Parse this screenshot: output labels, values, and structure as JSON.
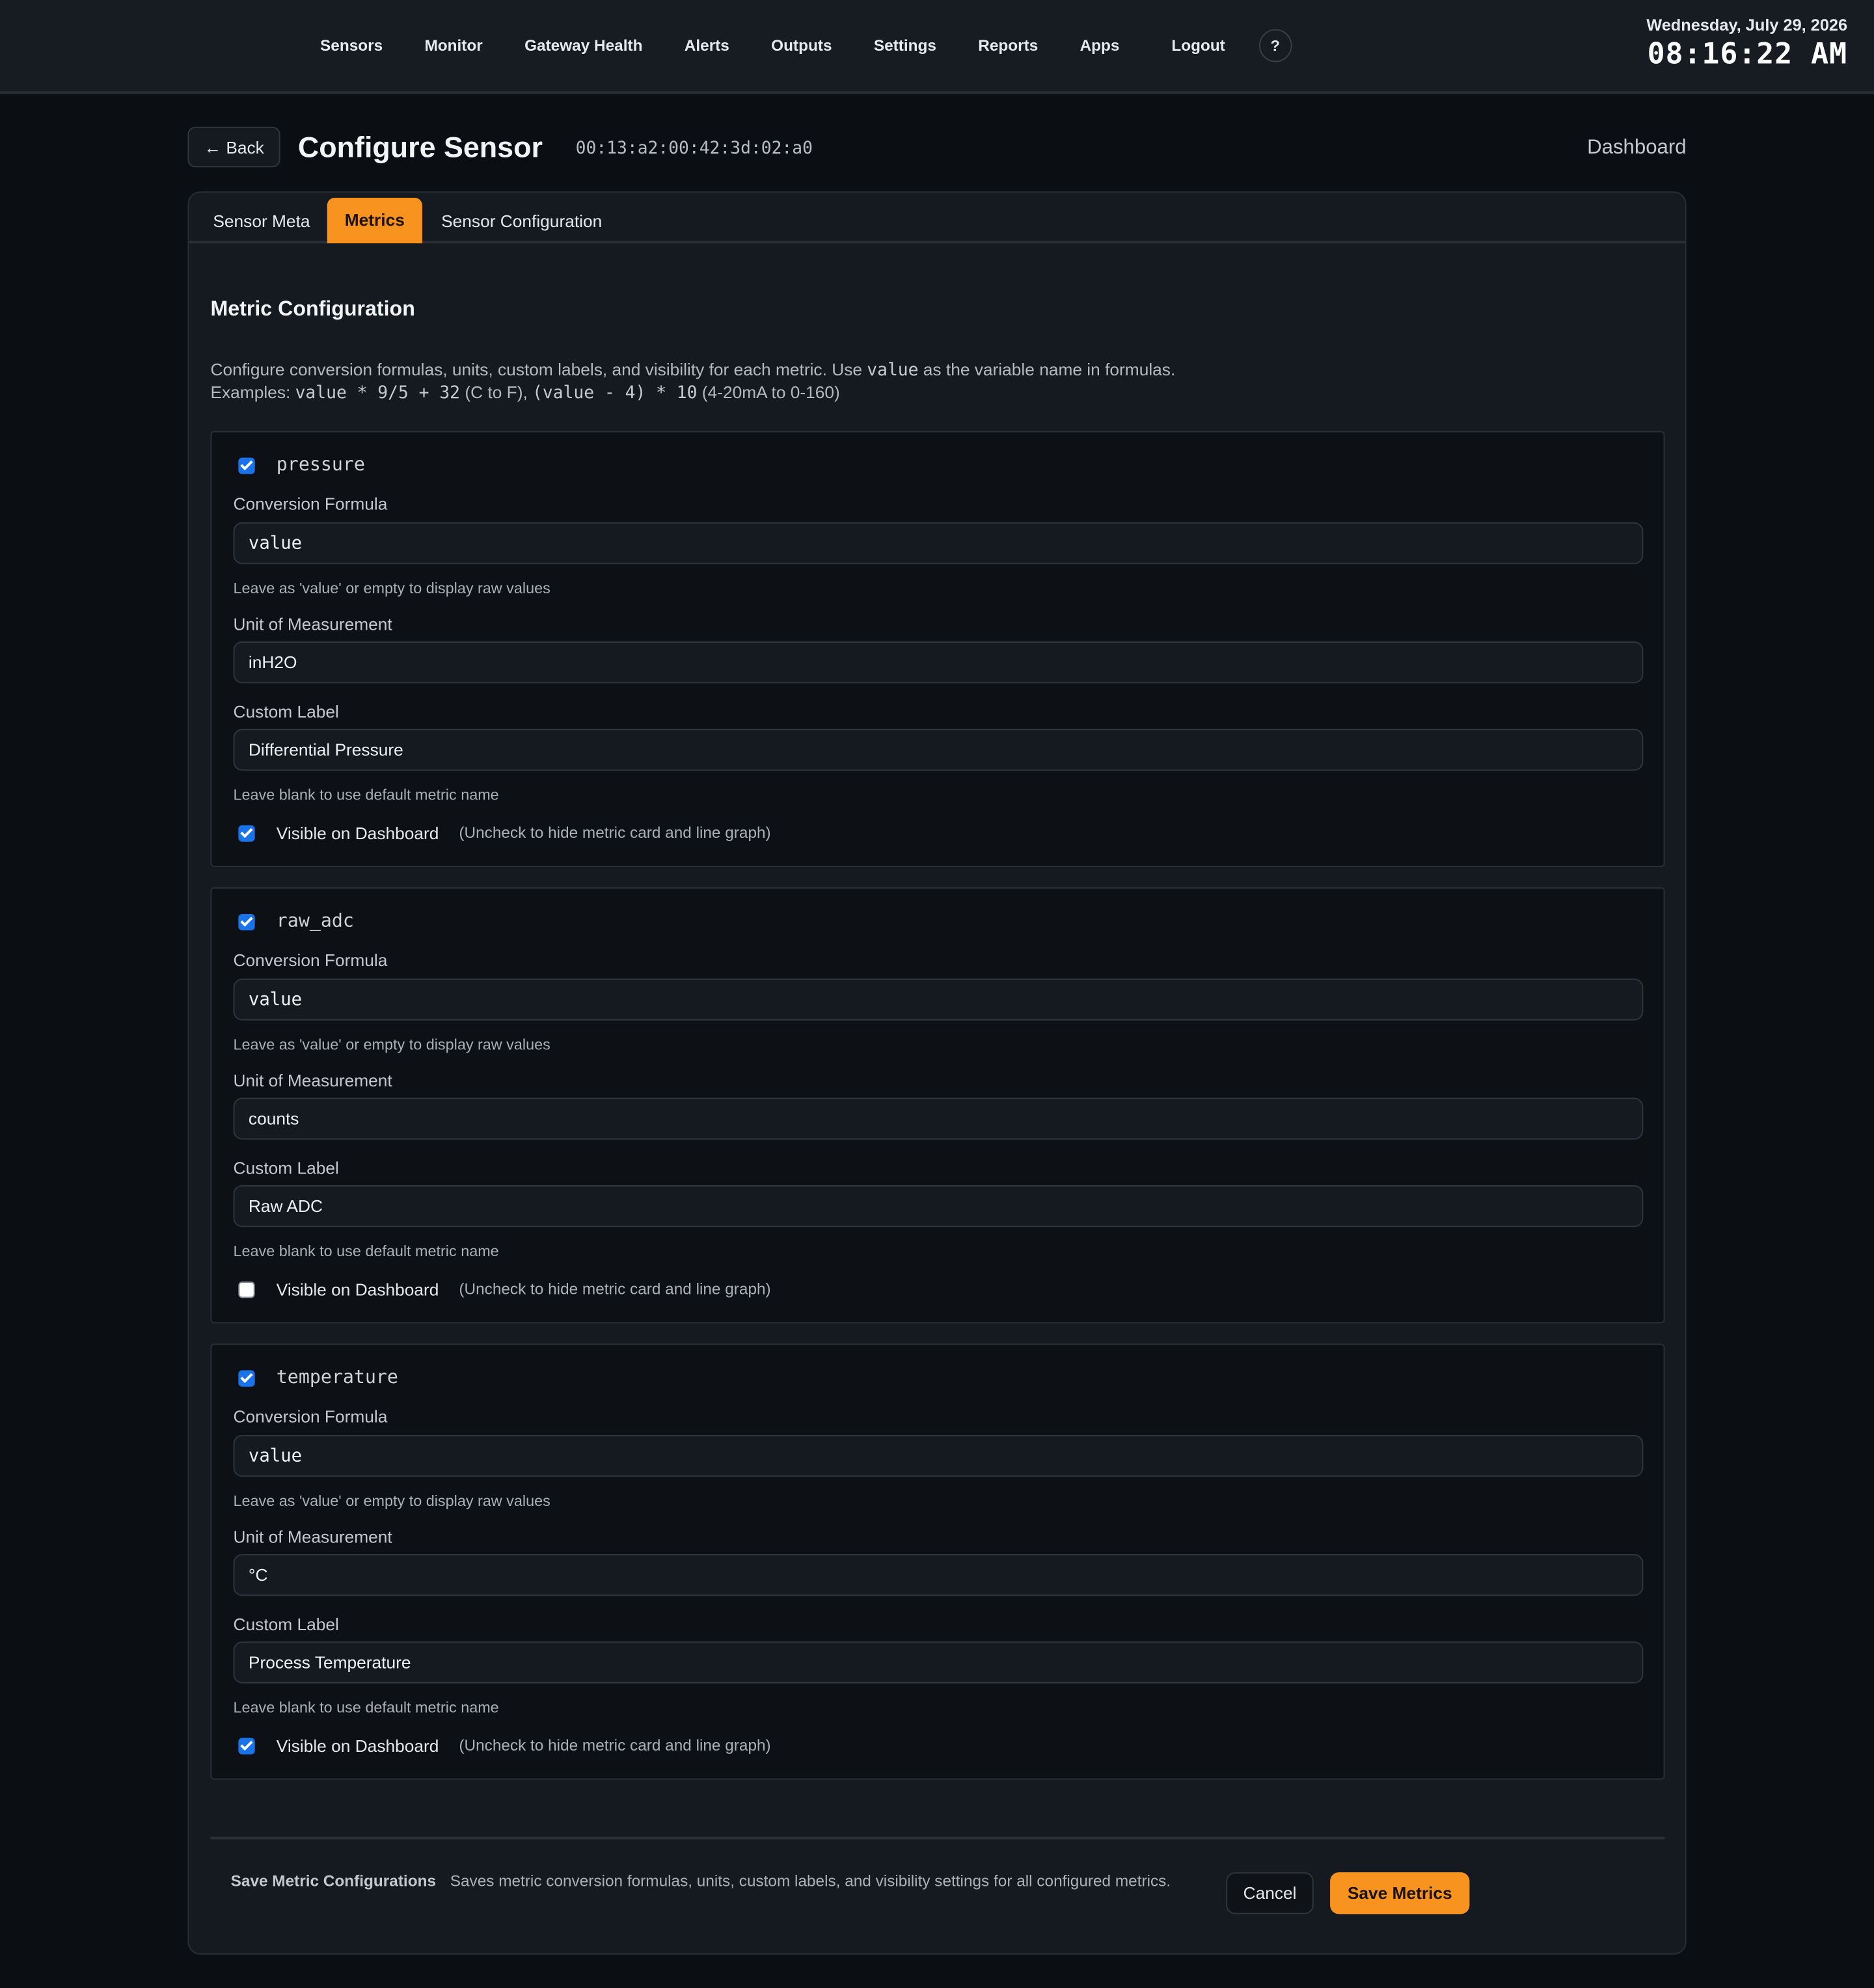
{
  "nav": {
    "items": [
      "Sensors",
      "Monitor",
      "Gateway Health",
      "Alerts",
      "Outputs",
      "Settings",
      "Reports",
      "Apps"
    ],
    "logout": "Logout",
    "help": "?"
  },
  "clock": {
    "date": "Wednesday, July 29, 2026",
    "time": "08:16:22 AM"
  },
  "header": {
    "back": "← Back",
    "title": "Configure Sensor",
    "sensor_id": "00:13:a2:00:42:3d:02:a0",
    "dashboard": "Dashboard"
  },
  "tabs": {
    "meta": "Sensor Meta",
    "metrics": "Metrics",
    "config": "Sensor Configuration",
    "active": "Metrics"
  },
  "section": {
    "title": "Metric Configuration",
    "desc_a": "Configure conversion formulas, units, custom labels, and visibility for each metric. Use ",
    "desc_code": "value",
    "desc_b": " as the variable name in formulas.",
    "ex_label": "Examples: ",
    "ex1_code": "value * 9/5 + 32",
    "ex1_text": " (C to F), ",
    "ex2_code": "(value - 4) * 10",
    "ex2_text": " (4-20mA to 0-160)"
  },
  "labels": {
    "formula": "Conversion Formula",
    "formula_hint": "Leave as 'value' or empty to display raw values",
    "unit": "Unit of Measurement",
    "custom": "Custom Label",
    "custom_hint": "Leave blank to use default metric name",
    "visible": "Visible on Dashboard",
    "visible_hint": "(Uncheck to hide metric card and line graph)"
  },
  "metrics": [
    {
      "name": "pressure",
      "enabled": true,
      "formula": "value",
      "unit": "inH2O",
      "label": "Differential Pressure",
      "visible": true
    },
    {
      "name": "raw_adc",
      "enabled": true,
      "formula": "value",
      "unit": "counts",
      "label": "Raw ADC",
      "visible": false
    },
    {
      "name": "temperature",
      "enabled": true,
      "formula": "value",
      "unit": "°C",
      "label": "Process Temperature",
      "visible": true
    }
  ],
  "footer": {
    "title": "Save Metric Configurations",
    "desc": "Saves metric conversion formulas, units, custom labels, and visibility settings for all configured metrics.",
    "cancel": "Cancel",
    "save": "Save Metrics"
  },
  "colors": {
    "accent": "#f7931e",
    "checkbox": "#1a73e8",
    "background": "#0b0e12",
    "panel": "#151920"
  }
}
